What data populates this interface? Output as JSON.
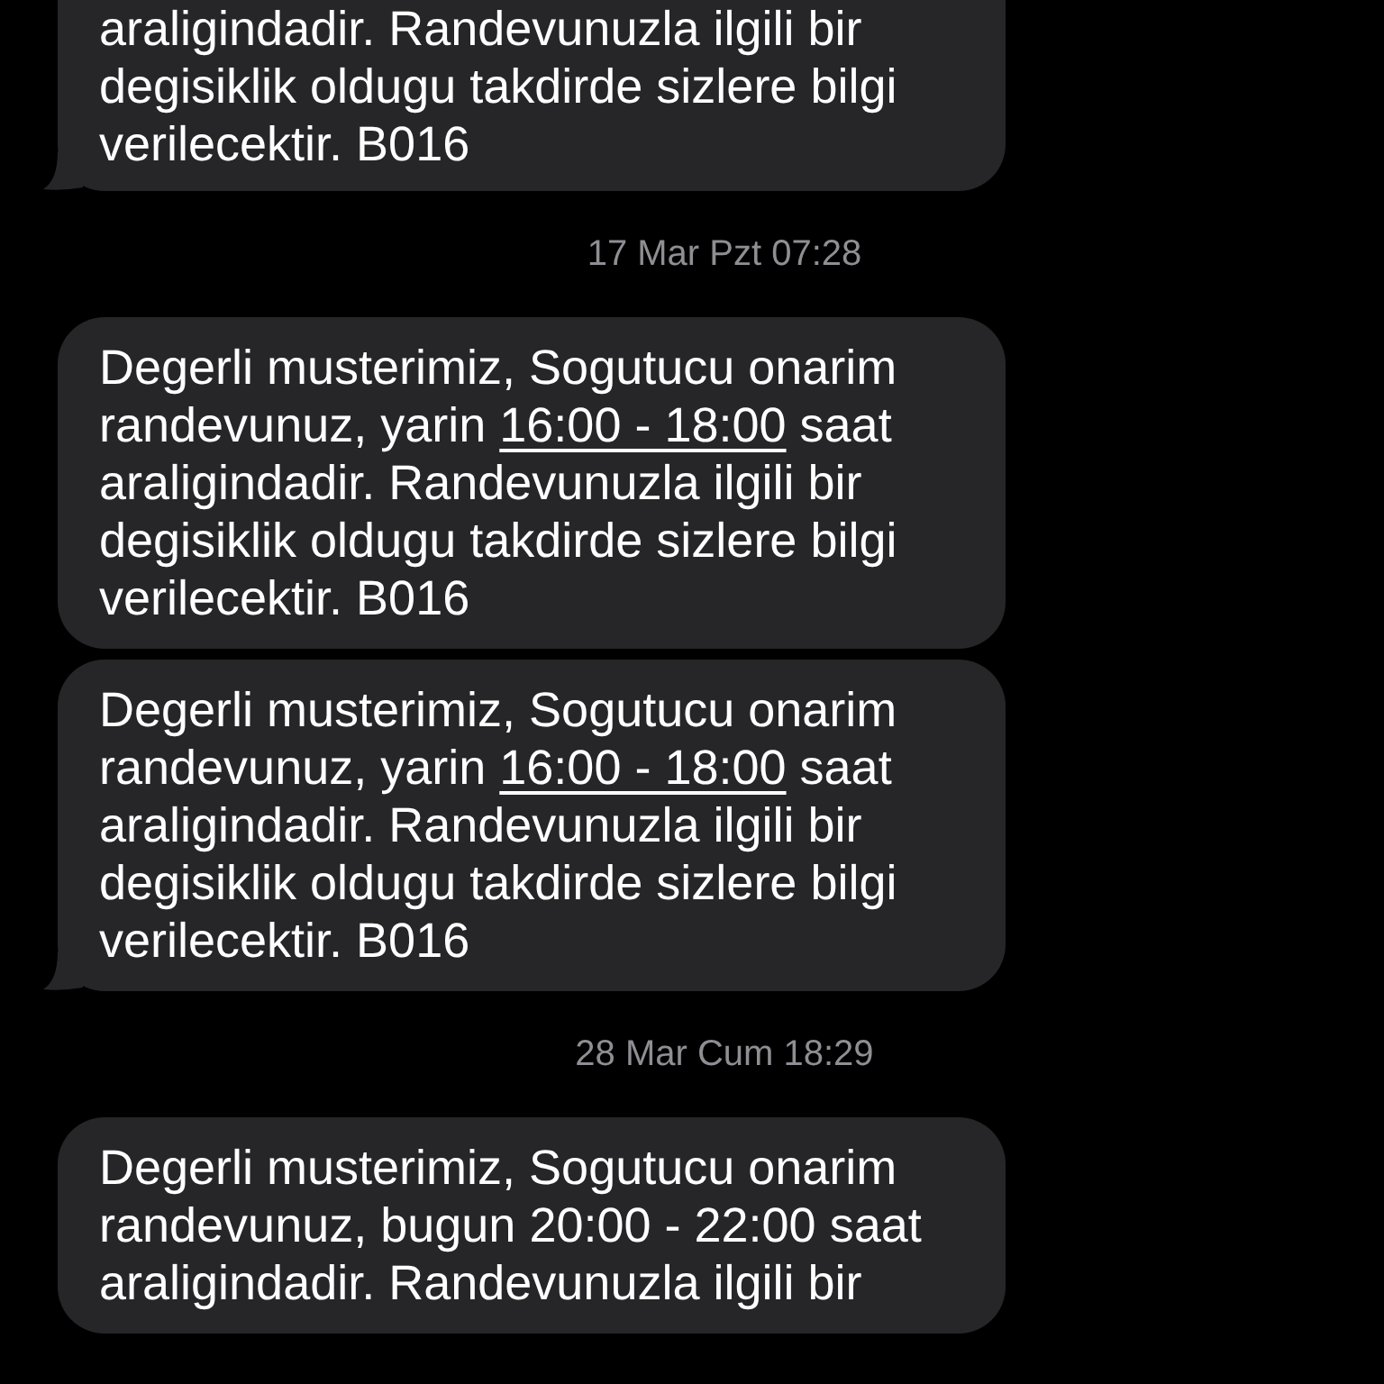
{
  "thread": [
    {
      "kind": "message",
      "tail": true,
      "parts": [
        {
          "text": "araligindadir. Randevunuzla ilgili bir degisiklik oldugu takdirde sizlere bilgi verilecektir. B016",
          "link": false
        }
      ]
    },
    {
      "kind": "timestamp",
      "text": "17 Mar Pzt 07:28"
    },
    {
      "kind": "message",
      "tail": false,
      "parts": [
        {
          "text": "Degerli musterimiz, Sogutucu onarim randevunuz, yarin ",
          "link": false
        },
        {
          "text": "16:00 - 18:00",
          "link": true
        },
        {
          "text": " saat araligindadir. Randevunuzla ilgili bir degisiklik oldugu takdirde sizlere bilgi verilecektir. B016",
          "link": false
        }
      ]
    },
    {
      "kind": "message",
      "tail": true,
      "parts": [
        {
          "text": "Degerli musterimiz, Sogutucu onarim randevunuz, yarin ",
          "link": false
        },
        {
          "text": "16:00 - 18:00",
          "link": true
        },
        {
          "text": " saat araligindadir. Randevunuzla ilgili bir degisiklik oldugu takdirde sizlere bilgi verilecektir. B016",
          "link": false
        }
      ]
    },
    {
      "kind": "timestamp",
      "text": "28 Mar Cum 18:29"
    },
    {
      "kind": "message",
      "tail": false,
      "parts": [
        {
          "text": "Degerli musterimiz, Sogutucu onarim randevunuz, bugun 20:00 - 22:00 saat araligindadir. Randevunuzla ilgili bir",
          "link": false
        }
      ]
    }
  ]
}
